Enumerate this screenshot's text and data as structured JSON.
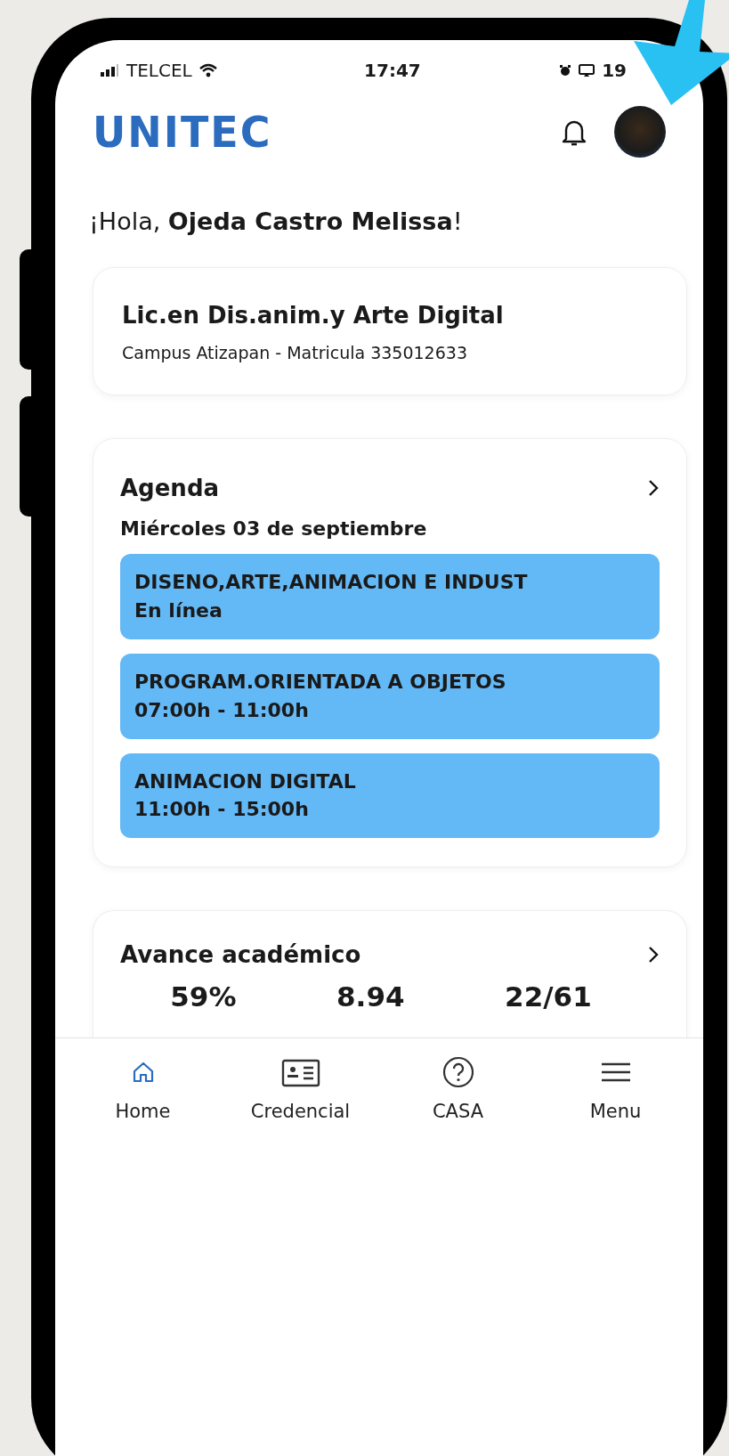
{
  "status_bar": {
    "carrier": "TELCEL",
    "time": "17:47",
    "battery": "19"
  },
  "header": {
    "logo": "UNITEC"
  },
  "greeting": "¡Hola, **Ojeda Castro Melissa**!",
  "program_card": {
    "title": "Lic.en Dis.anim.y Arte Digital",
    "subtitle": "Campus Atizapan - Matricula 335012633"
  },
  "agenda": {
    "title": "Agenda",
    "date": "Miércoles 03 de septiembre",
    "events": [
      {
        "name": "DISENO,ARTE,ANIMACION E INDUST",
        "detail": "En línea"
      },
      {
        "name": "PROGRAM.ORIENTADA A OBJETOS",
        "detail": "07:00h - 11:00h"
      },
      {
        "name": "ANIMACION DIGITAL",
        "detail": "11:00h - 15:00h"
      }
    ]
  },
  "progress": {
    "title": "Avance académico",
    "stats": [
      "59%",
      "8.94",
      "22/61"
    ]
  },
  "nav": [
    {
      "label": "Home",
      "kind": "home",
      "selected": true
    },
    {
      "label": "Credencial",
      "kind": "card",
      "selected": false
    },
    {
      "label": "CASA",
      "kind": "help",
      "selected": false
    },
    {
      "label": "Menu",
      "kind": "menu",
      "selected": false
    }
  ]
}
